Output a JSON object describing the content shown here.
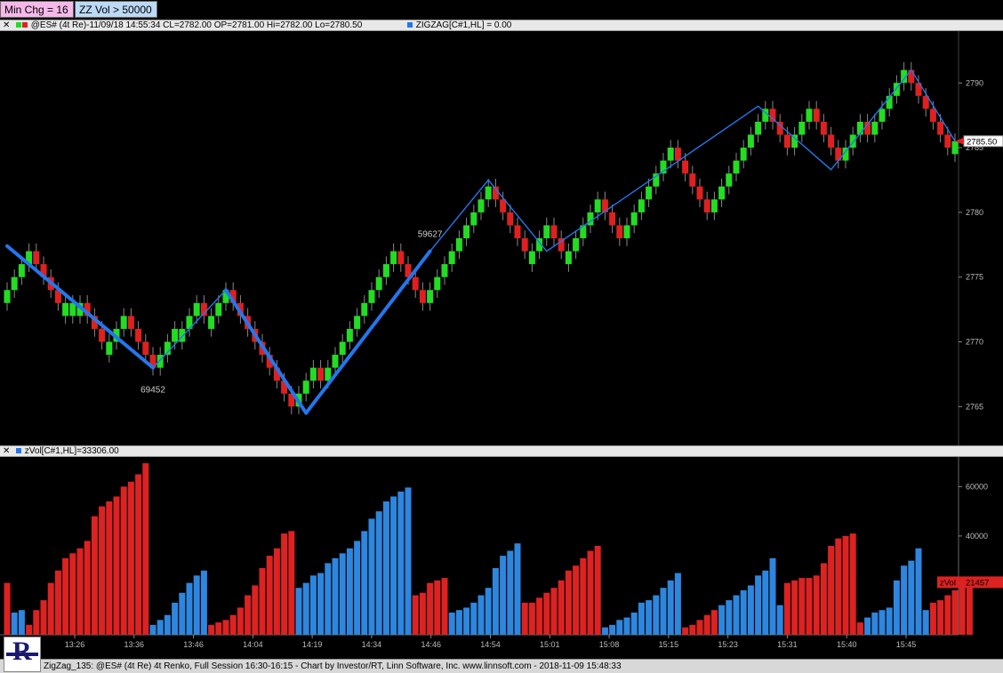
{
  "chips": {
    "min_chg": "Min Chg = 16",
    "zz_vol": "ZZ Vol > 50000"
  },
  "price_pane": {
    "header": "@ES# (4t Re)-11/09/18 14:55:34 CL=2782.00 OP=2781.00 Hi=2782.00 Lo=2780.50",
    "indicator": "ZIGZAG[C#1,HL] = 0.00",
    "last_price": "2785.50",
    "zigzag_labels": [
      "69452",
      "59627"
    ]
  },
  "volume_pane": {
    "header": "zVol[C#1,HL]=33306.00",
    "last_label": "zVol",
    "last_value": "21457"
  },
  "footer": "ZigZag_135: @ES# (4t Re) 4t Renko, Full Session 16:30-16:15 - Chart by Investor/RT, Linn Software, Inc. www.linnsoft.com - 2018-11-09 15:48:33",
  "colors": {
    "up": "#22dd22",
    "down": "#e02020",
    "zigzag": "#2277ee",
    "vol_up": "#2e86de",
    "vol_down": "#dd2222"
  },
  "chart_data": [
    {
      "type": "candlestick",
      "title": "@ES# (4t Re) 4t Renko",
      "ylim": [
        2762,
        2794
      ],
      "y_ticks": [
        2765,
        2770,
        2775,
        2780,
        2785,
        2790
      ],
      "x_ticks": [
        "13:26",
        "13:36",
        "13:46",
        "14:04",
        "14:19",
        "14:34",
        "14:46",
        "14:54",
        "15:01",
        "15:08",
        "15:15",
        "15:23",
        "15:31",
        "15:40",
        "15:45"
      ],
      "closes": [
        2774,
        2775,
        2776,
        2777,
        2776,
        2775,
        2774,
        2773,
        2773,
        2773,
        2773,
        2772,
        2771,
        2770,
        2770,
        2771,
        2772,
        2771,
        2770,
        2769,
        2768,
        2769,
        2770,
        2771,
        2771,
        2772,
        2773,
        2772,
        2772,
        2773,
        2774,
        2773,
        2772,
        2771,
        2770,
        2769,
        2768,
        2767,
        2766,
        2765,
        2766,
        2767,
        2768,
        2767,
        2768,
        2769,
        2770,
        2771,
        2772,
        2773,
        2774,
        2775,
        2776,
        2777,
        2776,
        2775,
        2774,
        2773,
        2774,
        2775,
        2776,
        2777,
        2778,
        2779,
        2780,
        2781,
        2782,
        2781,
        2780,
        2779,
        2778,
        2777,
        2777,
        2778,
        2779,
        2778,
        2777,
        2777,
        2778,
        2779,
        2780,
        2781,
        2780,
        2779,
        2778,
        2779,
        2780,
        2781,
        2782,
        2783,
        2784,
        2785,
        2784,
        2783,
        2782,
        2781,
        2780,
        2781,
        2782,
        2783,
        2784,
        2785,
        2786,
        2787,
        2788,
        2787,
        2786,
        2785,
        2786,
        2787,
        2788,
        2787,
        2786,
        2785,
        2784,
        2785,
        2786,
        2787,
        2786,
        2787,
        2788,
        2789,
        2790,
        2791,
        2790,
        2789,
        2788,
        2787,
        2786,
        2785,
        2785.5
      ],
      "zigzag": [
        {
          "bar": 0,
          "price": 2777.4
        },
        {
          "bar": 20,
          "price": 2768
        },
        {
          "bar": 30,
          "price": 2774
        },
        {
          "bar": 41,
          "price": 2764.5
        },
        {
          "bar": 58,
          "price": 2777
        },
        {
          "bar": 66,
          "price": 2782.5
        },
        {
          "bar": 74,
          "price": 2777
        },
        {
          "bar": 103,
          "price": 2788.2
        },
        {
          "bar": 113,
          "price": 2783.3
        },
        {
          "bar": 124,
          "price": 2791
        },
        {
          "bar": 130,
          "price": 2785.5
        }
      ]
    },
    {
      "type": "bar",
      "title": "zVol[C#1,HL]",
      "ylim": [
        0,
        72000
      ],
      "y_ticks": [
        20000,
        40000,
        60000
      ],
      "volumes": [
        21000,
        9000,
        10000,
        4000,
        10000,
        14000,
        21000,
        26000,
        31000,
        33000,
        35000,
        38000,
        48000,
        52000,
        54000,
        56000,
        60000,
        62000,
        65000,
        69452,
        4000,
        6000,
        8000,
        13000,
        17000,
        21000,
        24000,
        26000,
        4000,
        5000,
        6000,
        8000,
        11000,
        16000,
        20000,
        27000,
        32000,
        35000,
        41000,
        42000,
        19000,
        21000,
        24000,
        25000,
        29000,
        31000,
        33000,
        35000,
        38000,
        42000,
        47000,
        50000,
        54000,
        56000,
        58000,
        59627,
        16000,
        17000,
        21000,
        22000,
        23000,
        9000,
        10000,
        11000,
        13000,
        16000,
        19000,
        27000,
        32000,
        34000,
        37000,
        13000,
        13000,
        15000,
        17000,
        19000,
        22000,
        26000,
        28000,
        31000,
        34000,
        36000,
        3000,
        4000,
        6000,
        7000,
        9000,
        13000,
        14000,
        16000,
        19000,
        22000,
        25000,
        3000,
        4000,
        6000,
        8000,
        10000,
        12000,
        14000,
        16000,
        18000,
        20000,
        24000,
        26000,
        31000,
        12000,
        21000,
        22000,
        23000,
        23000,
        24000,
        29000,
        36000,
        39000,
        40000,
        41000,
        5000,
        7000,
        9000,
        10000,
        11000,
        22000,
        28000,
        30000,
        35000,
        10000,
        13000,
        14000,
        16000,
        18000,
        20000,
        21457
      ],
      "volume_colors": [
        "down",
        "up",
        "up",
        "down",
        "down",
        "down",
        "down",
        "down",
        "down",
        "down",
        "down",
        "down",
        "down",
        "down",
        "down",
        "down",
        "down",
        "down",
        "down",
        "down",
        "up",
        "up",
        "up",
        "up",
        "up",
        "up",
        "up",
        "up",
        "down",
        "down",
        "down",
        "down",
        "down",
        "down",
        "down",
        "down",
        "down",
        "down",
        "down",
        "down",
        "up",
        "up",
        "up",
        "up",
        "up",
        "up",
        "up",
        "up",
        "up",
        "up",
        "up",
        "up",
        "up",
        "up",
        "up",
        "up",
        "down",
        "down",
        "down",
        "down",
        "down",
        "up",
        "up",
        "up",
        "up",
        "up",
        "up",
        "up",
        "up",
        "up",
        "up",
        "down",
        "down",
        "down",
        "down",
        "down",
        "down",
        "down",
        "down",
        "down",
        "down",
        "down",
        "up",
        "up",
        "up",
        "up",
        "up",
        "up",
        "up",
        "up",
        "up",
        "up",
        "up",
        "down",
        "down",
        "down",
        "down",
        "down",
        "up",
        "up",
        "up",
        "up",
        "up",
        "up",
        "up",
        "up",
        "up",
        "down",
        "down",
        "down",
        "down",
        "down",
        "down",
        "down",
        "down",
        "down",
        "down",
        "down",
        "up",
        "up",
        "up",
        "up",
        "up",
        "up",
        "up",
        "up",
        "up",
        "down",
        "down",
        "down",
        "down",
        "down",
        "down",
        "down"
      ]
    }
  ]
}
